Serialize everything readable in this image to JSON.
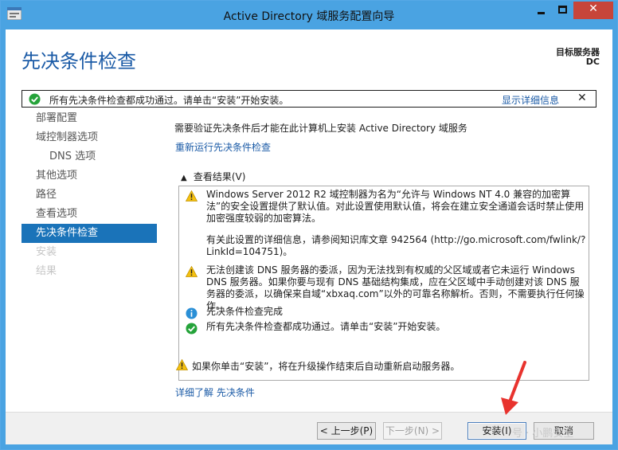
{
  "window": {
    "title": "Active Directory 域服务配置向导",
    "close_glyph": "✕"
  },
  "header": {
    "page_title": "先决条件检查",
    "target_server_label": "目标服务器",
    "target_server_name": "DC"
  },
  "banner": {
    "message": "所有先决条件检查都成功通过。请单击“安装”开始安装。",
    "details_link": "显示详细信息",
    "close_glyph": "✕"
  },
  "nav": {
    "items": [
      {
        "label": "部署配置",
        "state": "normal"
      },
      {
        "label": "域控制器选项",
        "state": "normal"
      },
      {
        "label": "DNS 选项",
        "state": "normal",
        "sub": true
      },
      {
        "label": "其他选项",
        "state": "normal"
      },
      {
        "label": "路径",
        "state": "normal"
      },
      {
        "label": "查看选项",
        "state": "normal"
      },
      {
        "label": "先决条件检查",
        "state": "active"
      },
      {
        "label": "安装",
        "state": "disabled"
      },
      {
        "label": "结果",
        "state": "disabled"
      }
    ]
  },
  "main": {
    "description": "需要验证先决条件后才能在此计算机上安装 Active Directory 域服务",
    "rerun_link": "重新运行先决条件检查",
    "view_results_label": "查看结果(V)",
    "chevron_glyph": "▲",
    "results": [
      {
        "icon": "warning",
        "text": "Windows Server 2012 R2 域控制器为名为“允许与 Windows NT 4.0 兼容的加密算法”的安全设置提供了默认值。对此设置使用默认值，将会在建立安全通道会话时禁止使用加密强度较弱的加密算法。"
      },
      {
        "icon": "none",
        "text": "有关此设置的详细信息，请参阅知识库文章 942564 (http://go.microsoft.com/fwlink/?LinkId=104751)。"
      },
      {
        "icon": "warning",
        "text": "无法创建该 DNS 服务器的委派，因为无法找到有权威的父区域或者它未运行 Windows DNS 服务器。如果你要与现有 DNS 基础结构集成，应在父区域中手动创建对该 DNS 服务器的委派，以确保来自域“xbxaq.com”以外的可靠名称解析。否则，不需要执行任何操作。"
      },
      {
        "icon": "info",
        "text": "先决条件检查完成"
      },
      {
        "icon": "success",
        "text": "所有先决条件检查都成功通过。请单击“安装”开始安装。"
      }
    ],
    "restart_warning": "如果你单击“安装”，将在升级操作结束后自动重新启动服务器。",
    "learn_more_link": "详细了解 先决条件"
  },
  "footer": {
    "prev_label": "< 上一步(P)",
    "next_label": "下一步(N) >",
    "install_label": "安装(I)",
    "cancel_label": "取消"
  },
  "watermark": "号 · 小鹏安全",
  "colors": {
    "title_bar": "#4aa3e2",
    "accent": "#1a5aa6",
    "nav_active": "#1a73b9",
    "close_button": "#c7453a",
    "arrow": "#e8332e"
  }
}
